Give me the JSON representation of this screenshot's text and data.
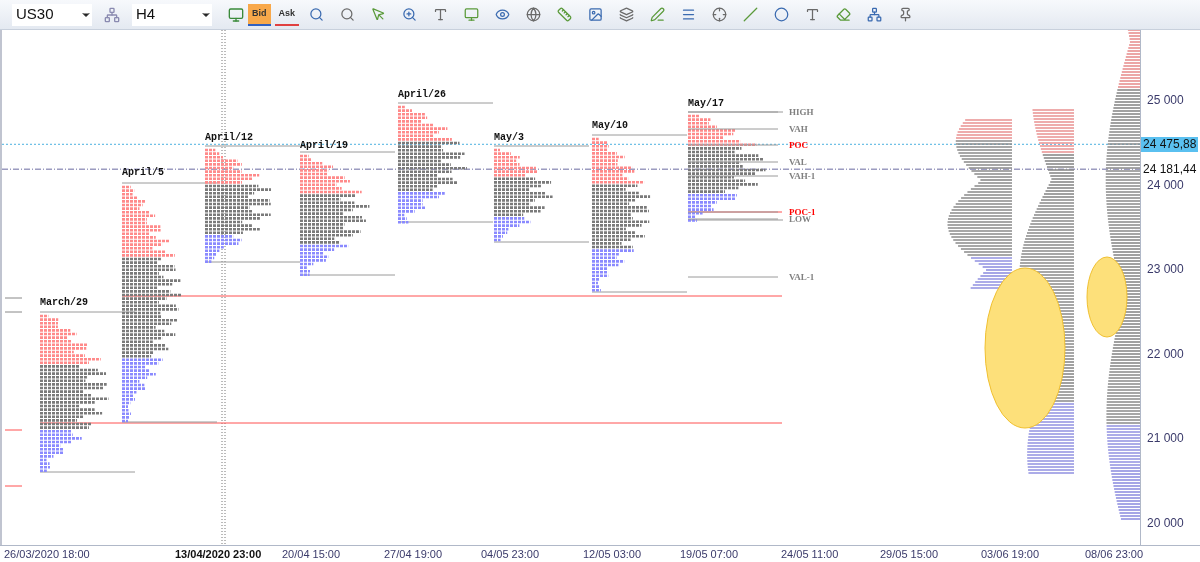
{
  "toolbar": {
    "symbol": "US30",
    "timeframe": "H4",
    "quote_buttons": [
      {
        "label": "Bid",
        "selected": true
      },
      {
        "label": "Ask",
        "selected": false
      }
    ]
  },
  "sessions": [
    {
      "label": "March/29"
    },
    {
      "label": "April/5"
    },
    {
      "label": "April/12"
    },
    {
      "label": "April/19"
    },
    {
      "label": "April/26"
    },
    {
      "label": "May/3"
    },
    {
      "label": "May/10"
    },
    {
      "label": "May/17"
    }
  ],
  "levels": [
    {
      "label": "HIGH",
      "color": "#808080"
    },
    {
      "label": "VAH",
      "color": "#808080"
    },
    {
      "label": "POC",
      "color": "#ff0000"
    },
    {
      "label": "VAL",
      "color": "#808080"
    },
    {
      "label": "VAH-1",
      "color": "#808080"
    },
    {
      "label": "POC-1",
      "color": "#ff0000"
    },
    {
      "label": "LOW",
      "color": "#808080"
    },
    {
      "label": "VAL-1",
      "color": "#808080"
    }
  ],
  "price_axis": {
    "ticks": [
      "25 000",
      "24 000",
      "23 000",
      "22 000",
      "21 000",
      "20 000"
    ],
    "markers": [
      {
        "label": "24 475,88",
        "kind": "current"
      },
      {
        "label": "24 181,44",
        "kind": "crosshair"
      }
    ]
  },
  "time_axis": [
    {
      "label": "26/03/2020 18:00",
      "kind": "tick"
    },
    {
      "label": "13/04/2020 23:00",
      "kind": "crosshair"
    },
    {
      "label": "20/04 15:00",
      "kind": "tick"
    },
    {
      "label": "27/04 19:00",
      "kind": "tick"
    },
    {
      "label": "04/05 23:00",
      "kind": "tick"
    },
    {
      "label": "12/05 03:00",
      "kind": "tick"
    },
    {
      "label": "19/05 07:00",
      "kind": "tick"
    },
    {
      "label": "24/05 11:00",
      "kind": "tick"
    },
    {
      "label": "29/05 15:00",
      "kind": "tick"
    },
    {
      "label": "03/06 19:00",
      "kind": "tick"
    },
    {
      "label": "08/06 23:00",
      "kind": "tick"
    }
  ]
}
